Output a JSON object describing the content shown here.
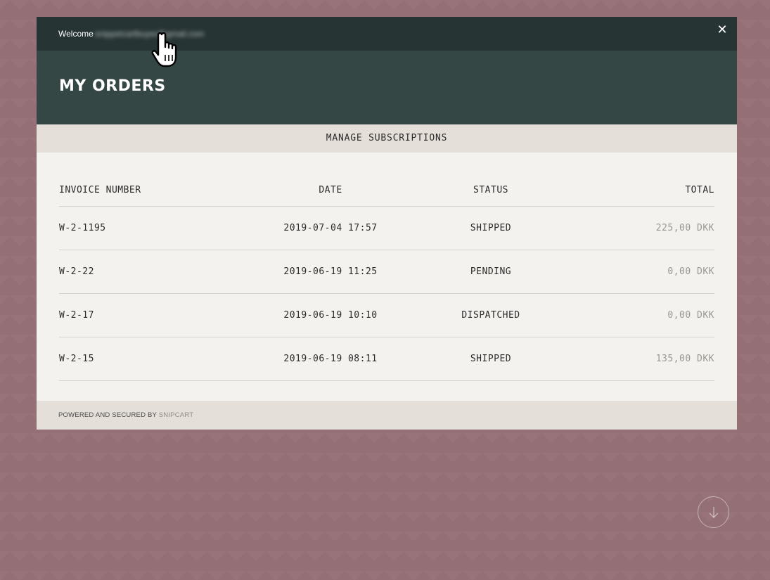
{
  "topbar": {
    "welcome_label": "Welcome",
    "user_email": "snippetcartbuyer@gmail.com",
    "close_icon": "close-icon",
    "close_glyph": "✕"
  },
  "header": {
    "title": "MY ORDERS"
  },
  "subscriptions": {
    "label": "MANAGE SUBSCRIPTIONS"
  },
  "orders": {
    "columns": {
      "invoice": "INVOICE NUMBER",
      "date": "DATE",
      "status": "STATUS",
      "total": "TOTAL"
    },
    "rows": [
      {
        "invoice": "W-2-1195",
        "date": "2019-07-04 17:57",
        "status": "SHIPPED",
        "total": "225,00 DKK"
      },
      {
        "invoice": "W-2-22",
        "date": "2019-06-19 11:25",
        "status": "PENDING",
        "total": "0,00 DKK"
      },
      {
        "invoice": "W-2-17",
        "date": "2019-06-19 10:10",
        "status": "DISPATCHED",
        "total": "0,00 DKK"
      },
      {
        "invoice": "W-2-15",
        "date": "2019-06-19 08:11",
        "status": "SHIPPED",
        "total": "135,00 DKK"
      }
    ]
  },
  "footer": {
    "text": "POWERED AND SECURED BY",
    "brand": "SNIPCART"
  },
  "scroll_button": {
    "icon": "arrow-down-icon"
  },
  "colors": {
    "background": "#946f75",
    "topbar": "#263433",
    "header": "#344745",
    "panel": "#f4f2ee",
    "bar": "#e4dfd9"
  }
}
